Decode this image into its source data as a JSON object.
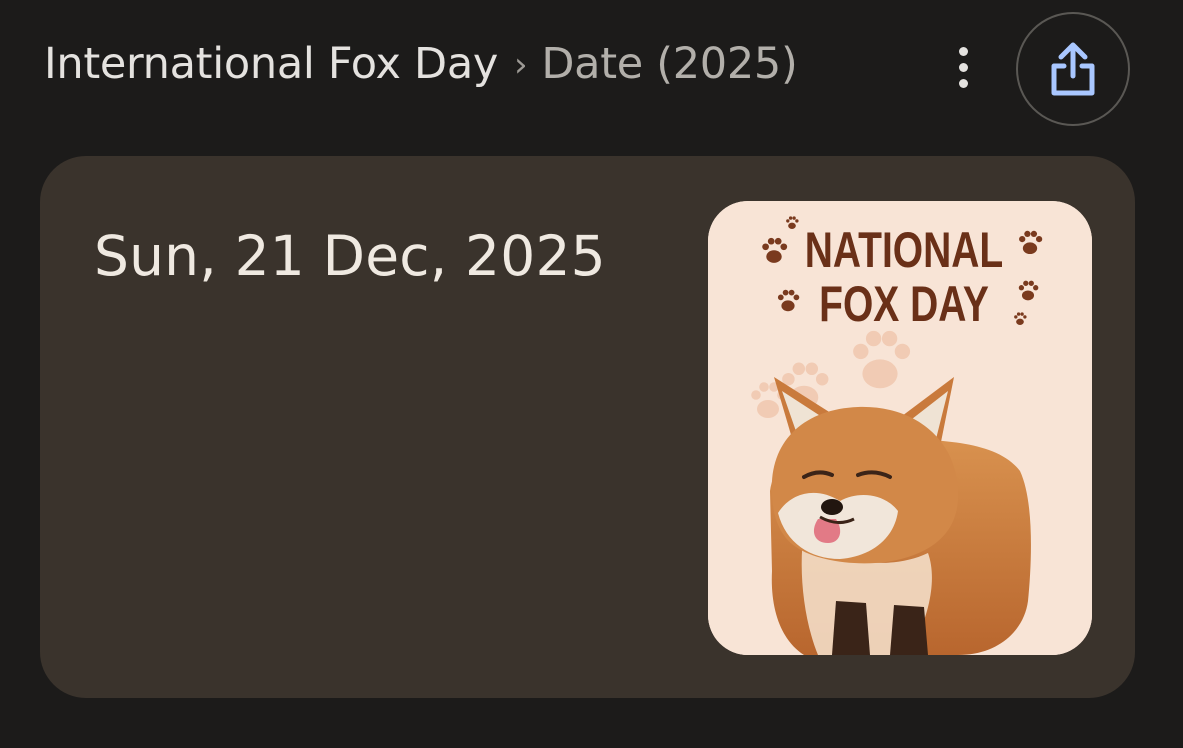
{
  "header": {
    "breadcrumb_title": "International Fox Day",
    "breadcrumb_separator": "›",
    "breadcrumb_subtitle": "Date (2025)",
    "more_icon": "more-vertical-icon",
    "share_icon": "share-icon"
  },
  "card": {
    "date": "Sun, 21 Dec, 2025",
    "image": {
      "title_line1": "NATIONAL",
      "title_line2": "FOX DAY"
    }
  },
  "colors": {
    "background": "#1c1b1a",
    "card_background": "#3a332c",
    "text_primary": "#e4e2df",
    "text_secondary": "#b2afaa",
    "share_icon": "#a9c7ff",
    "poster_background": "#f8e4d6",
    "poster_title": "#6a3018"
  }
}
